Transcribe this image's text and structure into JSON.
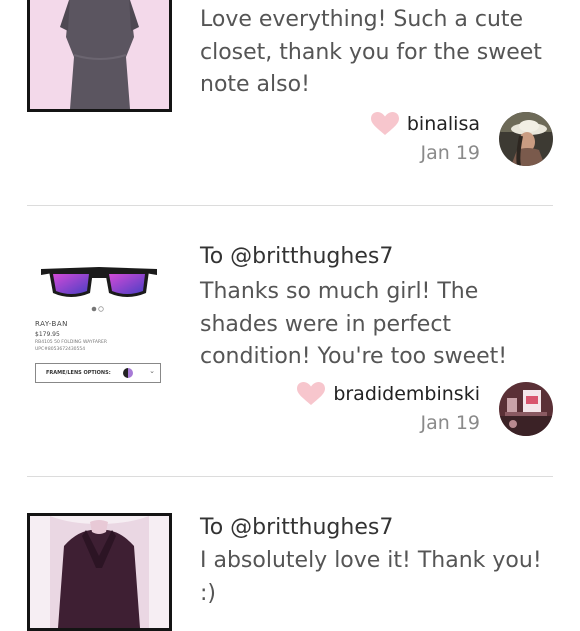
{
  "reviews": [
    {
      "recipient": "",
      "message_lines": [
        "Love everything! Such a cute",
        "closet, thank you for the sweet",
        "note also!"
      ],
      "username": "binalisa",
      "date": "Jan 19"
    },
    {
      "recipient": "To @britthughes7",
      "message_lines": [
        "Thanks so much girl! The",
        "shades were in perfect",
        "condition! You're too sweet!"
      ],
      "username": "bradidembinski",
      "date": "Jan 19",
      "product": {
        "brand": "RAY-BAN",
        "price": "$179.95",
        "model": "RB4105 50 FOLDING WAYFARER",
        "upc": "UPC#8053672430554",
        "option_label": "FRAME/LENS OPTIONS:"
      }
    },
    {
      "recipient": "To @britthughes7",
      "message_lines": [
        "I absolutely love it! Thank you! :)"
      ]
    }
  ],
  "colors": {
    "heart": "#f7c6cd",
    "divider": "#dcdcdc",
    "date": "#8a8a8a"
  },
  "icons": {
    "like": "heart-icon"
  }
}
